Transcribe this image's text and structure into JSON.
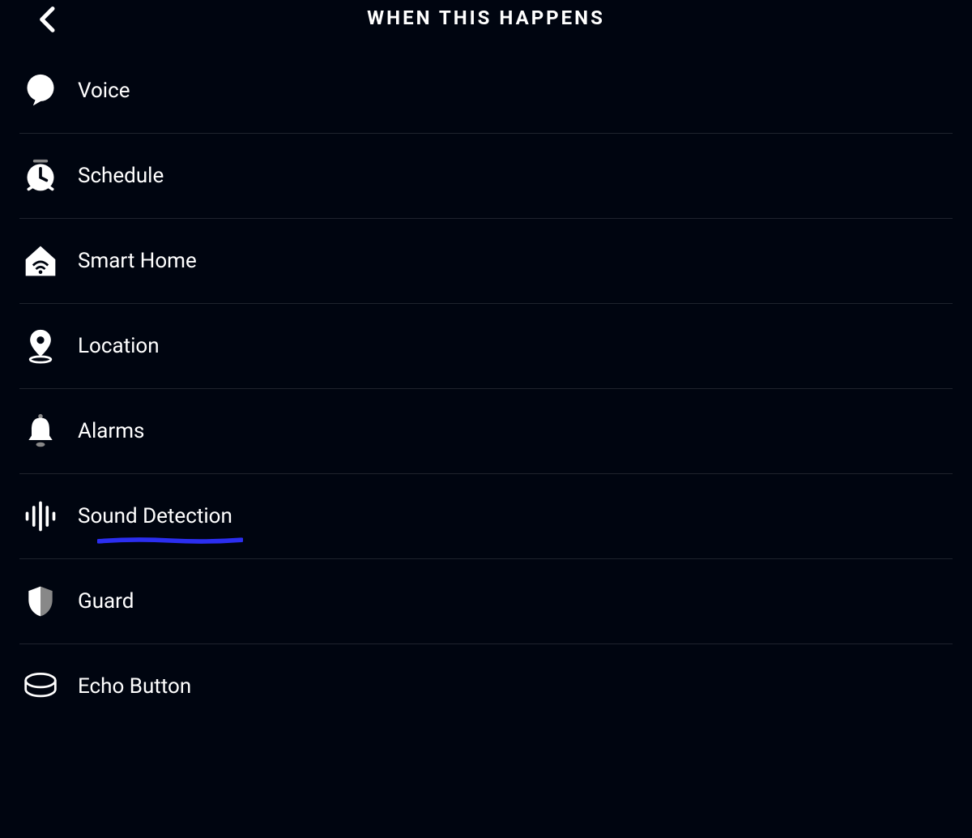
{
  "header": {
    "title": "WHEN THIS HAPPENS"
  },
  "items": [
    {
      "id": "voice",
      "label": "Voice",
      "icon": "speech-bubble-icon"
    },
    {
      "id": "schedule",
      "label": "Schedule",
      "icon": "clock-icon"
    },
    {
      "id": "smart-home",
      "label": "Smart Home",
      "icon": "home-wifi-icon"
    },
    {
      "id": "location",
      "label": "Location",
      "icon": "location-pin-icon"
    },
    {
      "id": "alarms",
      "label": "Alarms",
      "icon": "bell-icon"
    },
    {
      "id": "sound-detection",
      "label": "Sound Detection",
      "icon": "sound-wave-icon",
      "annotated": true
    },
    {
      "id": "guard",
      "label": "Guard",
      "icon": "shield-icon"
    },
    {
      "id": "echo-button",
      "label": "Echo Button",
      "icon": "echo-button-icon"
    }
  ],
  "annotation": {
    "color": "#2b2ef0"
  }
}
